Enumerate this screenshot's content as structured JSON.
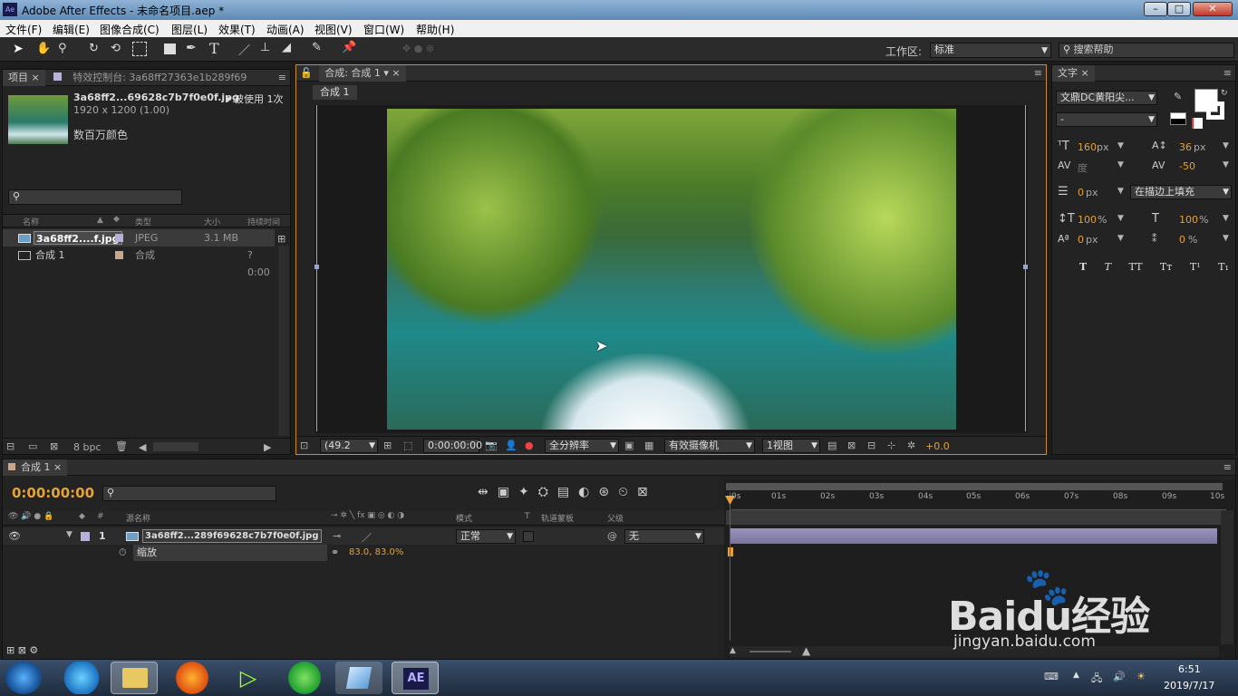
{
  "window": {
    "title": "Adobe After Effects - 未命名项目.aep *",
    "app_icon": "Ae"
  },
  "menu": [
    "文件(F)",
    "编辑(E)",
    "图像合成(C)",
    "图层(L)",
    "效果(T)",
    "动画(A)",
    "视图(V)",
    "窗口(W)",
    "帮助(H)"
  ],
  "toolbar": {
    "workspace_label": "工作区:",
    "workspace_value": "标准",
    "search_placeholder": "搜索帮助"
  },
  "project": {
    "tab_label": "项目",
    "effects_tab_label": "特效控制台: 3a68ff27363e1b289f69",
    "file_name": "3a68ff2...69628c7b7f0e0f.jpg",
    "used_text": "▾ 被使用 1次",
    "dimensions": "1920 x 1200 (1.00)",
    "colors": "数百万颜色",
    "columns": [
      "名称",
      "类型",
      "大小",
      "持续时间"
    ],
    "items": [
      {
        "name": "3a68ff2....f.jpg",
        "type": "JPEG",
        "size": "3.1 MB",
        "duration": ""
      },
      {
        "name": "合成 1",
        "type": "合成",
        "size": "",
        "duration": "? 0:00"
      }
    ],
    "bpc": "8 bpc"
  },
  "composition": {
    "tab_label": "合成: 合成 1",
    "breadcrumb": "合成 1",
    "zoom": "(49.2",
    "timecode": "0:00:00:00",
    "resolution": "全分辨率",
    "camera": "有效摄像机",
    "views": "1视图",
    "exposure": "+0.0"
  },
  "character": {
    "tab_label": "文字",
    "font": "文鼎DC黄阳尖...",
    "style": "-",
    "font_size": "160",
    "font_unit": "px",
    "leading": "36",
    "leading_unit": "px",
    "kerning": "度",
    "tracking": "-50",
    "stroke": "0",
    "stroke_unit": "px",
    "stroke_mode": "在描边上填充",
    "vscale": "100",
    "hscale": "100",
    "pct": "%",
    "baseline": "0",
    "baseline_unit": "px",
    "tsume": "0",
    "styles": [
      "T",
      "T",
      "TT",
      "Tт",
      "T¹",
      "T₁"
    ]
  },
  "timeline": {
    "tab_label": "合成 1",
    "timecode": "0:00:00:00",
    "col_source": "源名称",
    "col_mode": "模式",
    "col_t": "T",
    "col_trackmatte": "轨道蒙板",
    "col_parent": "父级",
    "layer_num": "1",
    "layer_name": "3a68ff2...289f69628c7b7f0e0f.jpg",
    "mode": "正常",
    "parent": "无",
    "prop_name": "缩放",
    "prop_value": "83.0, 83.0%",
    "ruler": [
      "0s",
      "01s",
      "02s",
      "03s",
      "04s",
      "05s",
      "06s",
      "07s",
      "08s",
      "09s",
      "10s"
    ]
  },
  "watermark": {
    "brand": "Baidu经验",
    "url": "jingyan.baidu.com"
  },
  "taskbar": {
    "time": "6:51",
    "date": "2019/7/17",
    "active_app": "AE"
  }
}
